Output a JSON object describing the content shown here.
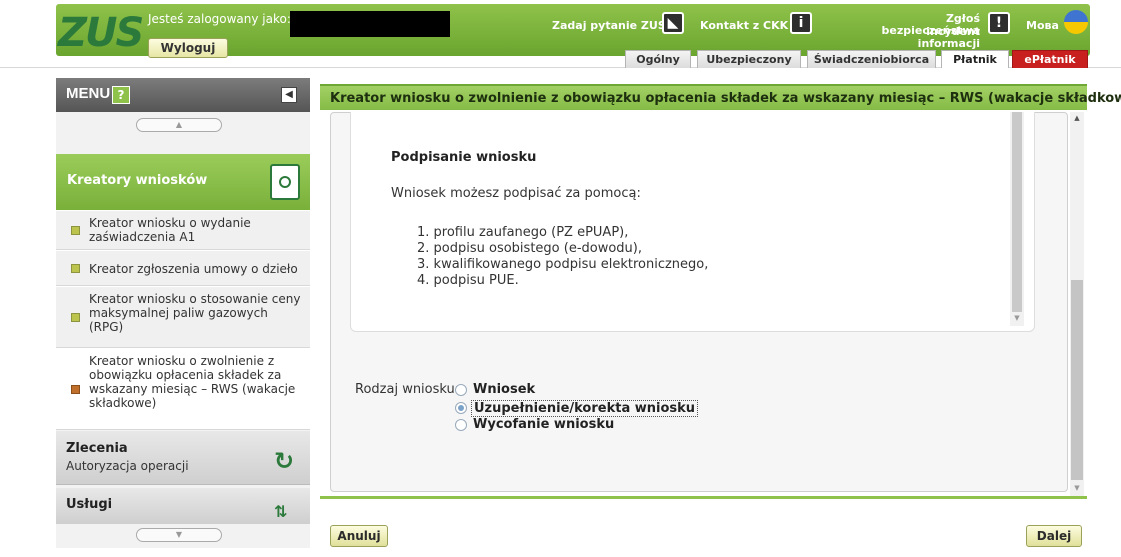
{
  "header": {
    "logo": "ZUS",
    "logged_as_label": "Jesteś zalogowany jako:",
    "logout_label": "Wyloguj",
    "ask_question": "Zadaj pytanie ZUS",
    "contact_ckk": "Kontakt z CKK",
    "report_incident_line1": "Zgłoś incydent",
    "report_incident_line2": "bezpieczeństwa informacji",
    "language": "Мова",
    "tabs": [
      "Ogólny",
      "Ubezpieczony",
      "Świadczeniobiorca",
      "Płatnik",
      "ePłatnik"
    ],
    "active_tab": "Płatnik"
  },
  "sidebar": {
    "menu_title": "MENU",
    "help_icon": "?",
    "section_title": "Kreatory wniosków",
    "items": [
      {
        "label": "Kreator wniosku o wydanie zaświadczenia A1"
      },
      {
        "label": "Kreator zgłoszenia umowy o dzieło"
      },
      {
        "label": "Kreator wniosku o stosowanie ceny maksymalnej paliw gazowych (RPG)"
      },
      {
        "label": "Kreator wniosku o zwolnienie z obowiązku opłacenia składek za wskazany miesiąc – RWS (wakacje składkowe)"
      }
    ],
    "zlecenia_title": "Zlecenia",
    "zlecenia_subtitle": "Autoryzacja operacji",
    "uslugi_title": "Usługi"
  },
  "main": {
    "title": "Kreator wniosku o zwolnienie z obowiązku opłacenia składek za wskazany miesiąc – RWS (wakacje składkowe)",
    "sign_title": "Podpisanie wniosku",
    "sign_desc": "Wniosek możesz podpisać za pomocą:",
    "sign_options": [
      "1. profilu zaufanego (PZ ePUAP),",
      "2. podpisu osobistego (e-dowodu),",
      "3. kwalifikowanego podpisu elektronicznego,",
      "4. podpisu PUE."
    ],
    "request_type_label": "Rodzaj wniosku:",
    "request_types": [
      "Wniosek",
      "Uzupełnienie/korekta wniosku",
      "Wycofanie wniosku"
    ],
    "selected_request_type": "Uzupełnienie/korekta wniosku"
  },
  "buttons": {
    "cancel": "Anuluj",
    "next": "Dalej"
  },
  "colors": {
    "brand_green": "#8fc24a",
    "zus_green": "#2c7a3b",
    "eplatnik_red": "#c8201e"
  }
}
